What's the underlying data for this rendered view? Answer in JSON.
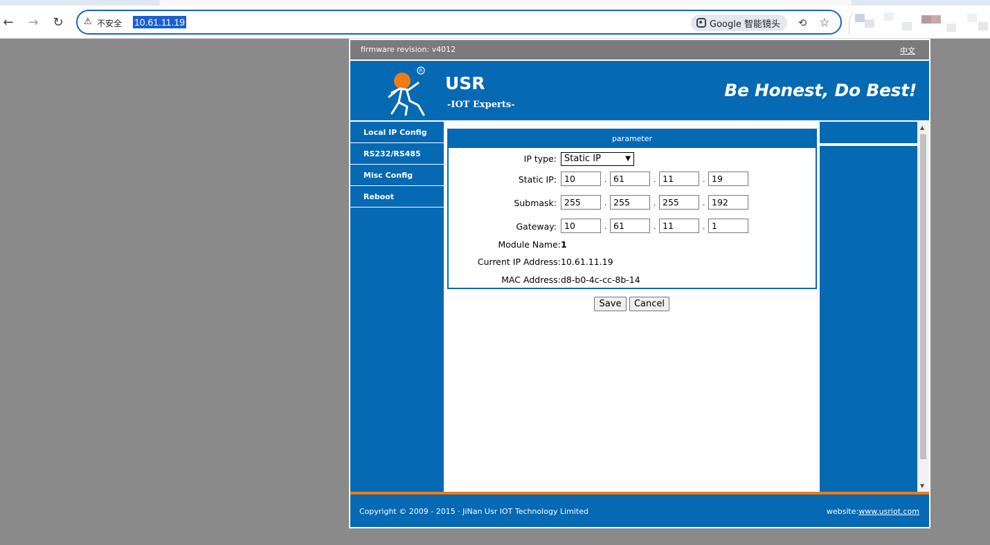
{
  "browser": {
    "security_label": "不安全",
    "url": "10.61.11.19",
    "lens_label": "Google 智能镜头",
    "icons": [
      "back-arrow-icon",
      "forward-arrow-icon",
      "reload-icon",
      "warning-icon",
      "lens-icon",
      "translate-icon",
      "star-icon"
    ]
  },
  "header": {
    "firmware_label": "firmware revision:",
    "firmware_version": "v4012",
    "lang_link": "中文",
    "brand": "USR",
    "brand_sub": "-IOT Experts-",
    "slogan": "Be Honest, Do Best!",
    "colors": {
      "blue": "#0569b4",
      "orange": "#f07a14"
    }
  },
  "sidebar": {
    "items": [
      {
        "label": "Local IP Config"
      },
      {
        "label": "RS232/RS485"
      },
      {
        "label": "Misc Config"
      },
      {
        "label": "Reboot"
      }
    ]
  },
  "parameter": {
    "title": "parameter",
    "ip_type": {
      "label": "IP type:",
      "value": "Static IP"
    },
    "static_ip": {
      "label": "Static IP:",
      "octets": [
        "10",
        "61",
        "11",
        "19"
      ]
    },
    "submask": {
      "label": "Submask:",
      "octets": [
        "255",
        "255",
        "255",
        "192"
      ]
    },
    "gateway": {
      "label": "Gateway:",
      "octets": [
        "10",
        "61",
        "11",
        "1"
      ]
    },
    "module_name": {
      "label": "Module Name:",
      "value": "1"
    },
    "current_ip": {
      "label": "Current IP Address:",
      "value": "10.61.11.19"
    },
    "mac": {
      "label": "MAC Address:",
      "value": "d8-b0-4c-cc-8b-14"
    }
  },
  "actions": {
    "save": "Save",
    "cancel": "Cancel"
  },
  "footer": {
    "copyright": "Copyright © 2009 - 2015 · JiNan Usr IOT Technology Limited",
    "website_label": "website:",
    "website_link": "www.usriot.com"
  }
}
